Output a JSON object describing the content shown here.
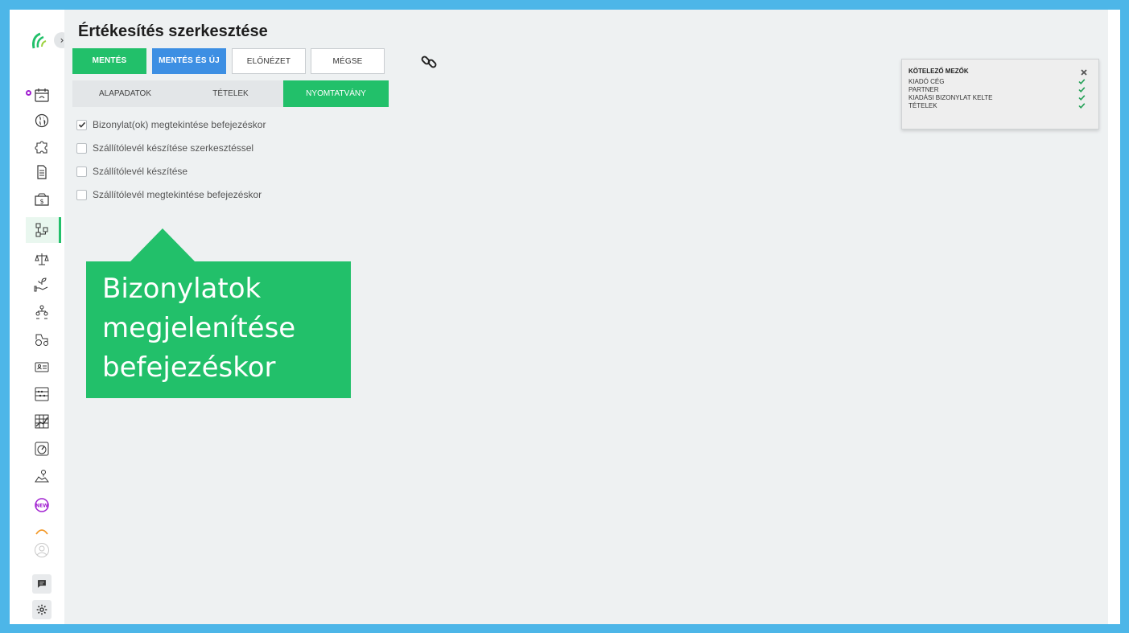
{
  "page": {
    "title": "Értékesítés szerkesztése"
  },
  "toolbar": {
    "save": "MENTÉS",
    "save_new": "MENTÉS ÉS ÚJ",
    "preview": "ELŐNÉZET",
    "cancel": "MÉGSE",
    "link_icon": "link-icon"
  },
  "tabs": [
    {
      "label": "ALAPADATOK",
      "active": false
    },
    {
      "label": "TÉTELEK",
      "active": false
    },
    {
      "label": "NYOMTATVÁNY",
      "active": true
    }
  ],
  "options": [
    {
      "label": "Bizonylat(ok) megtekintése befejezéskor",
      "checked": true
    },
    {
      "label": "Szállítólevél készítése szerkesztéssel",
      "checked": false
    },
    {
      "label": "Szállítólevél készítése",
      "checked": false
    },
    {
      "label": "Szállítólevél megtekintése befejezéskor",
      "checked": false
    }
  ],
  "callout": {
    "text": "Bizonylatok megjelenítése befejezéskor"
  },
  "required_fields": {
    "title": "KÖTELEZŐ MEZŐK",
    "items": [
      "KIADÓ CÉG",
      "PARTNER",
      "KIADÁSI BIZONYLAT KELTE",
      "TÉTELEK"
    ]
  },
  "sidebar": {
    "icons": [
      "calendar-icon",
      "globe-icon",
      "puzzle-icon",
      "document-icon",
      "invoice-icon",
      "workflow-icon",
      "scale-icon",
      "plant-hand-icon",
      "hierarchy-icon",
      "tractor-icon",
      "id-card-icon",
      "abacus-icon",
      "grid-chart-icon",
      "gauge-icon",
      "map-pin-icon",
      "new-badge-icon",
      "arc-icon",
      "user-avatar-icon",
      "chat-icon",
      "gear-icon"
    ],
    "new_badge": "NEW"
  },
  "colors": {
    "accent_green": "#22c06a",
    "accent_blue": "#3d8fe3",
    "frame_blue": "#4db6e8",
    "main_bg": "#eef1f2"
  }
}
